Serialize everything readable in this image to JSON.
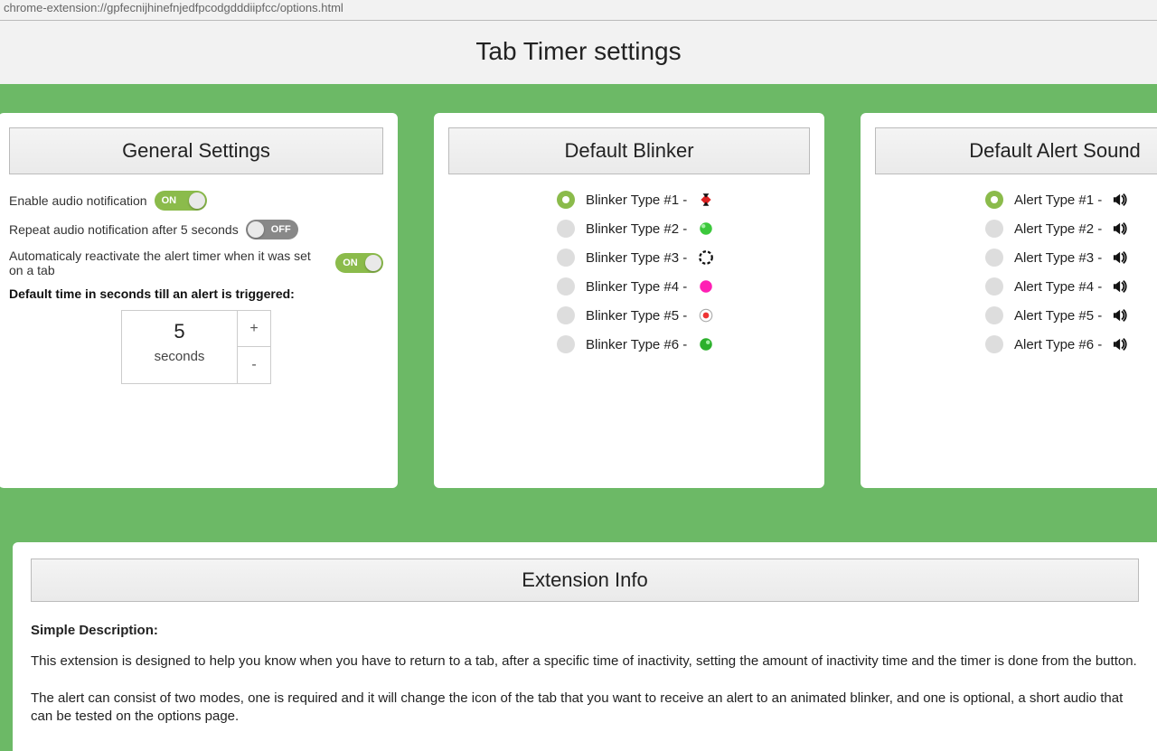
{
  "addr": "chrome-extension://gpfecnijhinefnjedfpcodgdddiipfcc/options.html",
  "header": {
    "title": "Tab Timer settings"
  },
  "general": {
    "title": "General Settings",
    "enable_label": "Enable audio notification",
    "enable_state": "ON",
    "repeat_label": "Repeat audio notification after 5 seconds",
    "repeat_state": "OFF",
    "reactivate_label": "Automaticaly reactivate the alert timer when it was set on a tab",
    "reactivate_state": "ON",
    "default_time_label": "Default time in seconds till an alert is triggered:",
    "default_time_value": "5",
    "default_time_unit": "seconds"
  },
  "blinker": {
    "title": "Default Blinker",
    "items": [
      {
        "label": "Blinker Type #1 -",
        "selected": true
      },
      {
        "label": "Blinker Type #2 -",
        "selected": false
      },
      {
        "label": "Blinker Type #3 -",
        "selected": false
      },
      {
        "label": "Blinker Type #4 -",
        "selected": false
      },
      {
        "label": "Blinker Type #5 -",
        "selected": false
      },
      {
        "label": "Blinker Type #6 -",
        "selected": false
      }
    ]
  },
  "alert": {
    "title": "Default Alert Sound",
    "items": [
      {
        "label": "Alert Type #1 -",
        "selected": true
      },
      {
        "label": "Alert Type #2 -",
        "selected": false
      },
      {
        "label": "Alert Type #3 -",
        "selected": false
      },
      {
        "label": "Alert Type #4 -",
        "selected": false
      },
      {
        "label": "Alert Type #5 -",
        "selected": false
      },
      {
        "label": "Alert Type #6 -",
        "selected": false
      }
    ]
  },
  "info": {
    "title": "Extension Info",
    "subtitle": "Simple Description:",
    "p1": "This extension is designed to help you know when you have to return to a tab, after a specific time of inactivity, setting the amount of inactivity time and the timer is done from the button.",
    "p2": "The alert can consist of two modes, one is required and it will change the icon of the tab that you want to receive an alert to an animated blinker, and one is optional, a short audio that can be tested on the options page."
  }
}
